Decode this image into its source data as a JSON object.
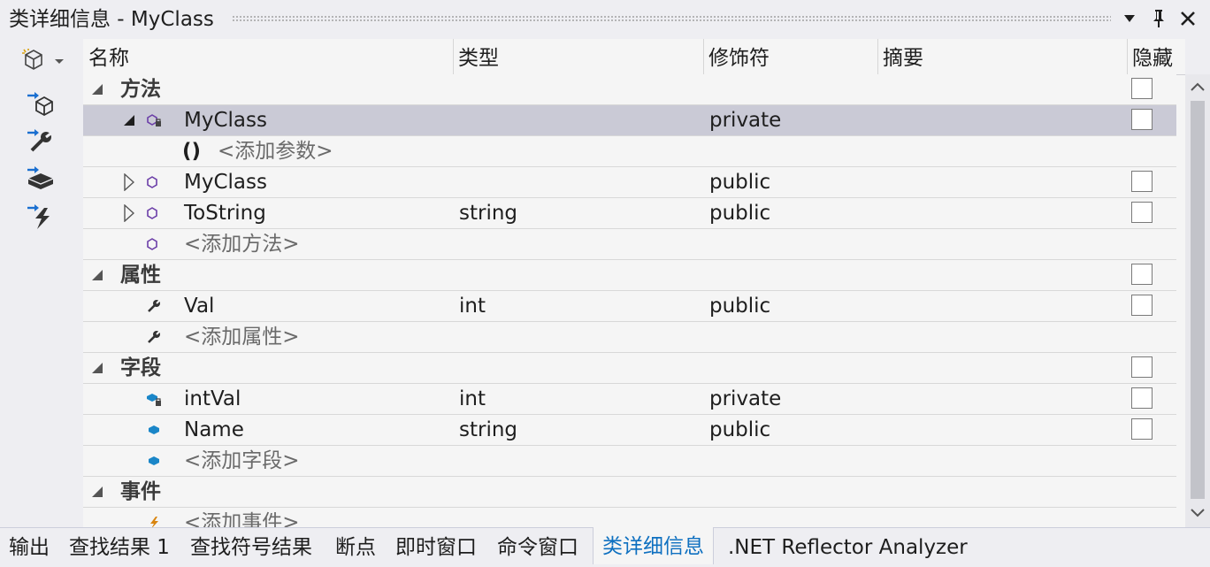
{
  "window": {
    "title": "类详细信息 - MyClass"
  },
  "columns": {
    "name": "名称",
    "type": "类型",
    "modifier": "修饰符",
    "summary": "摘要",
    "hidden": "隐藏"
  },
  "groups": {
    "methods": "方法",
    "properties": "属性",
    "fields": "字段",
    "events": "事件"
  },
  "rows": {
    "m1": {
      "name": "MyClass",
      "type": "",
      "modifier": "private"
    },
    "m1_param": {
      "name": "<添加参数>"
    },
    "m2": {
      "name": "MyClass",
      "type": "",
      "modifier": "public"
    },
    "m3": {
      "name": "ToString",
      "type": "string",
      "modifier": "public"
    },
    "m_add": {
      "name": "<添加方法>"
    },
    "p1": {
      "name": "Val",
      "type": "int",
      "modifier": "public"
    },
    "p_add": {
      "name": "<添加属性>"
    },
    "f1": {
      "name": "intVal",
      "type": "int",
      "modifier": "private"
    },
    "f2": {
      "name": "Name",
      "type": "string",
      "modifier": "public"
    },
    "f_add": {
      "name": "<添加字段>"
    },
    "e_add": {
      "name": "<添加事件>"
    }
  },
  "param_glyph": "()",
  "bottom_tabs": [
    {
      "label": "输出"
    },
    {
      "label": "查找结果 1"
    },
    {
      "label": "查找符号结果"
    },
    {
      "label": "断点"
    },
    {
      "label": "即时窗口"
    },
    {
      "label": "命令窗口"
    },
    {
      "label": "类详细信息",
      "active": true
    },
    {
      "label": ".NET Reflector Analyzer"
    }
  ],
  "colors": {
    "method_icon": "#6c3fa8",
    "field_icon": "#1a86c8",
    "event_icon": "#d9850f",
    "active_tab_text": "#0e70c0",
    "selected_row": "#cacad6"
  },
  "icons": {
    "toolbar": [
      "new-member-icon",
      "add-method-icon",
      "add-property-icon",
      "add-field-icon",
      "add-event-icon"
    ],
    "window": [
      "dropdown-arrow-icon",
      "pin-icon",
      "close-icon"
    ]
  }
}
